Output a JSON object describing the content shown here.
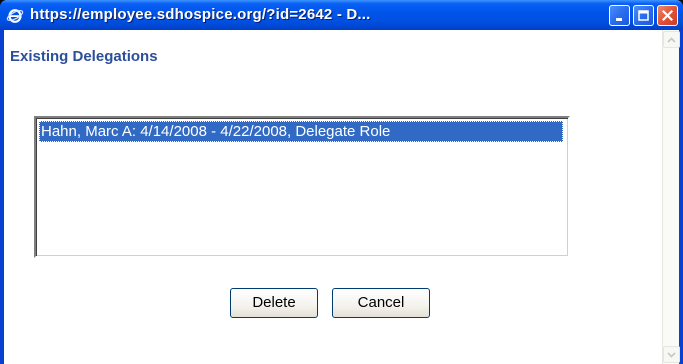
{
  "window": {
    "title": "https://employee.sdhospice.org/?id=2642 - D...",
    "icons": {
      "app": "ie-icon",
      "minimize": "minimize-icon",
      "maximize": "maximize-icon",
      "close": "close-icon"
    }
  },
  "dialog": {
    "heading": "Existing Delegations",
    "delegations": [
      {
        "text": "Hahn, Marc A: 4/14/2008 - 4/22/2008, Delegate Role",
        "selected": true
      }
    ],
    "buttons": {
      "delete": "Delete",
      "cancel": "Cancel"
    }
  },
  "colors": {
    "titlebar": "#0055ea",
    "heading": "#2c4f9c",
    "selection": "#316ac5",
    "close_button": "#e0533a"
  }
}
